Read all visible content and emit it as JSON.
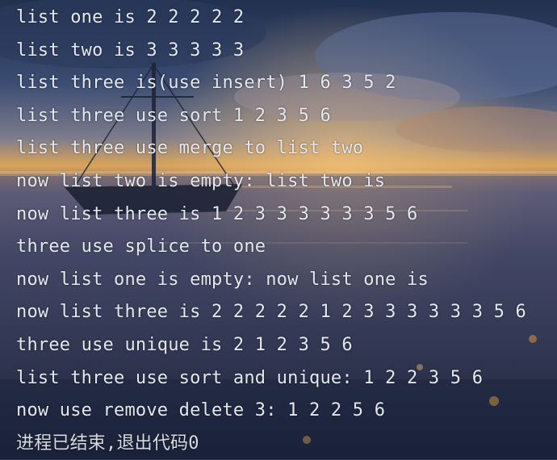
{
  "console": {
    "lines": [
      "list one is 2 2 2 2 2",
      "list two is 3 3 3 3 3",
      "list three is(use insert) 1 6 3 5 2",
      "list three use sort 1 2 3 5 6",
      "list three use merge to list two",
      "now list two is empty: list two is",
      "now list three is 1 2 3 3 3 3 3 3 5 6",
      "three use splice to one",
      "now list one is empty: now list one is",
      "now list three is 2 2 2 2 2 1 2 3 3 3 3 3 3 5 6",
      "three use unique is 2 1 2 3 5 6",
      "list three use sort and unique: 1 2 2 3 5 6",
      "now use remove delete 3: 1 2 2 5 6",
      "进程已结束,退出代码0"
    ]
  },
  "colors": {
    "text": "#e6e8ef",
    "sky_top": "#1f2a44",
    "horizon": "#d9a35a",
    "sea": "#27304a"
  }
}
